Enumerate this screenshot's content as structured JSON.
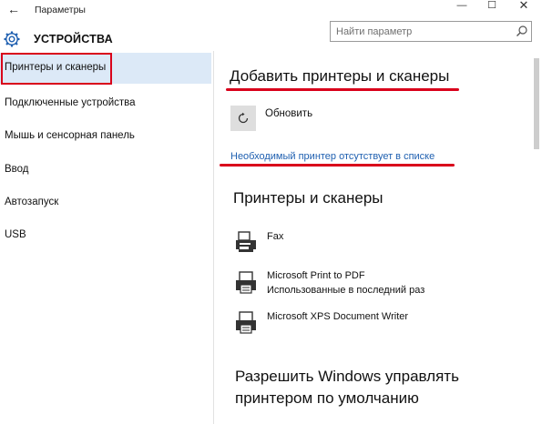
{
  "window": {
    "back_glyph": "←",
    "title": "Параметры",
    "minimize_glyph": "—",
    "maximize_glyph": "☐",
    "close_glyph": "✕"
  },
  "header": {
    "icon": "gear-icon",
    "section_title": "УСТРОЙСТВА",
    "search_placeholder": "Найти параметр",
    "search_icon": "search-icon"
  },
  "nav": {
    "items": [
      {
        "label": "Принтеры и сканеры",
        "selected": true
      },
      {
        "label": "Подключенные устройства",
        "selected": false
      },
      {
        "label": "Мышь и сенсорная панель",
        "selected": false
      },
      {
        "label": "Ввод",
        "selected": false
      },
      {
        "label": "Автозапуск",
        "selected": false
      },
      {
        "label": "USB",
        "selected": false
      }
    ]
  },
  "main": {
    "add_heading": "Добавить принтеры и сканеры",
    "refresh_label": "Обновить",
    "missing_link": "Необходимый принтер отсутствует в списке",
    "printers_heading": "Принтеры и сканеры",
    "devices": [
      {
        "name": "Fax",
        "sub": "",
        "icon": "fax-icon"
      },
      {
        "name": "Microsoft Print to PDF",
        "sub": "Использованные в последний раз",
        "icon": "printer-icon"
      },
      {
        "name": "Microsoft XPS Document Writer",
        "sub": "",
        "icon": "printer-icon"
      }
    ],
    "default_heading_line1": "Разрешить Windows управлять",
    "default_heading_line2": "принтером по умолчанию"
  },
  "colors": {
    "accent_red": "#d9001b",
    "link_blue": "#1e5fb0",
    "selected_bg": "#dce9f7"
  }
}
